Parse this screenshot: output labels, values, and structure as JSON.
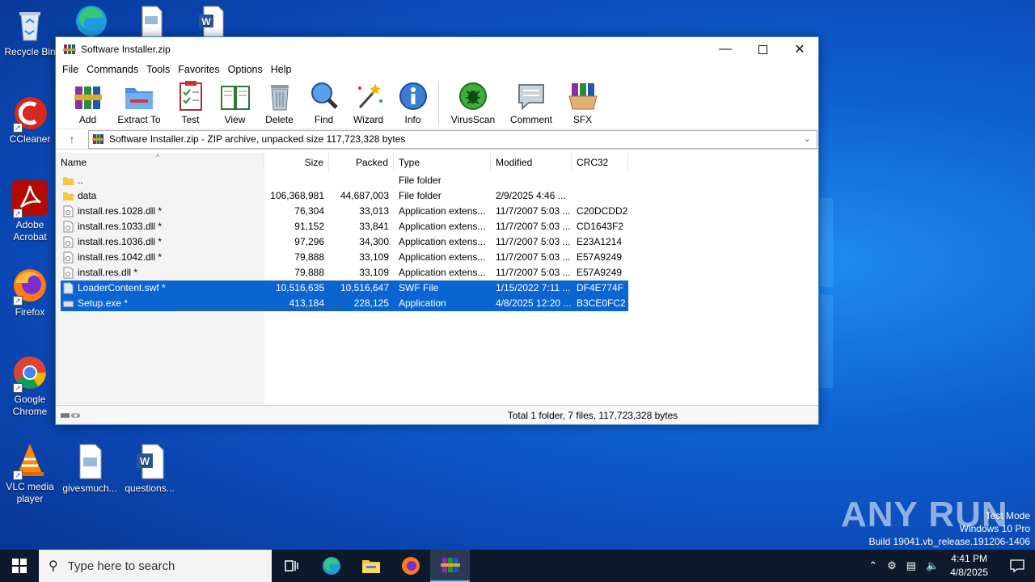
{
  "desktop": {
    "icons": [
      {
        "label": "Recycle Bin"
      },
      {
        "label": "CCleaner"
      },
      {
        "label": "Adobe Acrobat"
      },
      {
        "label": "Firefox"
      },
      {
        "label": "Google Chrome"
      },
      {
        "label": "VLC media player"
      },
      {
        "label": "givesmuch..."
      },
      {
        "label": "questions..."
      }
    ],
    "watermark": {
      "brand": "ANY RUN",
      "line1": "Test Mode",
      "line2": "Windows 10 Pro",
      "line3": "Build 19041.vb_release.191206-1406"
    }
  },
  "window": {
    "title": "Software Installer.zip",
    "menu": [
      "File",
      "Commands",
      "Tools",
      "Favorites",
      "Options",
      "Help"
    ],
    "toolbar": [
      {
        "label": "Add",
        "icon": "add-icon"
      },
      {
        "label": "Extract To",
        "icon": "extract-icon"
      },
      {
        "label": "Test",
        "icon": "test-icon"
      },
      {
        "label": "View",
        "icon": "view-icon"
      },
      {
        "label": "Delete",
        "icon": "delete-icon"
      },
      {
        "label": "Find",
        "icon": "find-icon"
      },
      {
        "label": "Wizard",
        "icon": "wizard-icon"
      },
      {
        "label": "Info",
        "icon": "info-icon"
      },
      {
        "label": "VirusScan",
        "icon": "virusscan-icon"
      },
      {
        "label": "Comment",
        "icon": "comment-icon"
      },
      {
        "label": "SFX",
        "icon": "sfx-icon"
      }
    ],
    "address": "Software Installer.zip - ZIP archive, unpacked size 117,723,328 bytes",
    "columns": {
      "name": "Name",
      "size": "Size",
      "packed": "Packed",
      "type": "Type",
      "modified": "Modified",
      "crc": "CRC32"
    },
    "files": [
      {
        "name": "..",
        "size": "",
        "packed": "",
        "type": "File folder",
        "modified": "",
        "crc": "",
        "kind": "folder"
      },
      {
        "name": "data",
        "size": "106,368,981",
        "packed": "44,687,003",
        "type": "File folder",
        "modified": "2/9/2025 4:46 ...",
        "crc": "",
        "kind": "folder"
      },
      {
        "name": "install.res.1028.dll *",
        "size": "76,304",
        "packed": "33,013",
        "type": "Application extens...",
        "modified": "11/7/2007 5:03 ...",
        "crc": "C20DCDD2",
        "kind": "dll"
      },
      {
        "name": "install.res.1033.dll *",
        "size": "91,152",
        "packed": "33,841",
        "type": "Application extens...",
        "modified": "11/7/2007 5:03 ...",
        "crc": "CD1643F2",
        "kind": "dll"
      },
      {
        "name": "install.res.1036.dll *",
        "size": "97,296",
        "packed": "34,300",
        "type": "Application extens...",
        "modified": "11/7/2007 5:03 ...",
        "crc": "E23A1214",
        "kind": "dll"
      },
      {
        "name": "install.res.1042.dll *",
        "size": "79,888",
        "packed": "33,109",
        "type": "Application extens...",
        "modified": "11/7/2007 5:03 ...",
        "crc": "E57A9249",
        "kind": "dll"
      },
      {
        "name": "install.res.dll *",
        "size": "79,888",
        "packed": "33,109",
        "type": "Application extens...",
        "modified": "11/7/2007 5:03 ...",
        "crc": "E57A9249",
        "kind": "dll"
      },
      {
        "name": "LoaderContent.swf *",
        "size": "10,516,635",
        "packed": "10,516,647",
        "type": "SWF File",
        "modified": "1/15/2022 7:11 ...",
        "crc": "DF4E774F",
        "kind": "swf",
        "selected": true
      },
      {
        "name": "Setup.exe *",
        "size": "413,184",
        "packed": "228,125",
        "type": "Application",
        "modified": "4/8/2025 12:20 ...",
        "crc": "B3CE0FC2",
        "kind": "exe",
        "selected": true
      }
    ],
    "status": "Total 1 folder, 7 files, 117,723,328 bytes"
  },
  "taskbar": {
    "search_placeholder": "Type here to search",
    "time": "4:41 PM",
    "date": "4/8/2025"
  }
}
